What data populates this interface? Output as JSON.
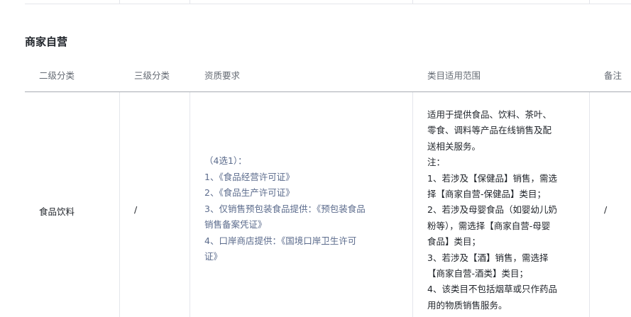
{
  "section": {
    "title": "商家自营"
  },
  "table": {
    "headers": [
      "二级分类",
      "三级分类",
      "资质要求",
      "类目适用范围",
      "备注"
    ],
    "row": {
      "level2": "食品饮料",
      "level3": "/",
      "qualification_lines": [
        "（4选1）：",
        "1、《食品经营许可证》",
        "2、《食品生产许可证》",
        "3、仅销售预包装食品提供：《预包装食品",
        "销售备案凭证》",
        "4、口岸商店提供：《国境口岸卫生许可",
        "证》"
      ],
      "scope_lines": [
        "适用于提供食品、饮料、茶叶、",
        "零食、调料等产品在线销售及配",
        "送相关服务。",
        "注：",
        "1、若涉及【保健品】销售，需选",
        "择【商家自营-保健品】类目；",
        "2、若涉及母婴食品（如婴幼儿奶",
        "粉等），需选择【商家自营-母婴",
        "食品】类目；",
        "3、若涉及【酒】销售，需选择",
        "【商家自营-酒类】类目；",
        "4、该类目不包括烟草或只作药品",
        "用的物质销售服务。"
      ],
      "remark": "/"
    }
  },
  "colors": {
    "header_text": "#646a73",
    "link_text": "#5b6b8c",
    "border": "#e4e6eb"
  }
}
